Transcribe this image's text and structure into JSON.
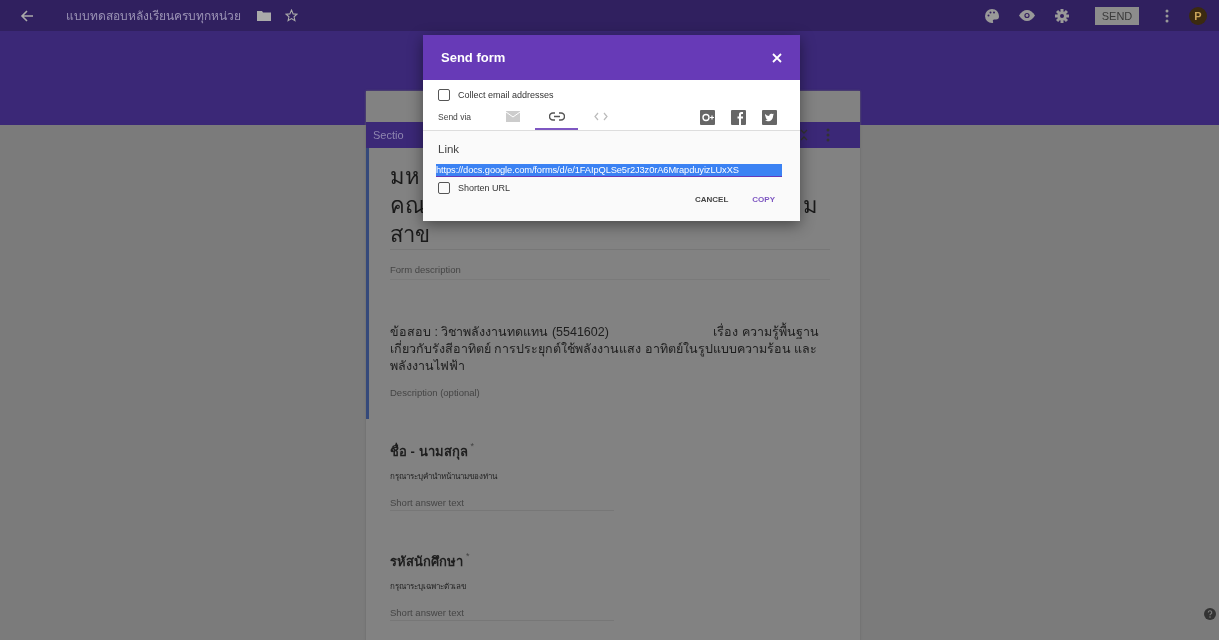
{
  "topbar": {
    "title": "แบบทดสอบหลังเรียนครบทุกหน่วย",
    "send_button": "SEND",
    "avatar": "P"
  },
  "form": {
    "section_tab": "Sectio",
    "title_lines": [
      {
        "left": "มห"
      },
      {
        "left": "คณ",
        "right": "ม"
      },
      {
        "left": "สาข"
      }
    ],
    "description_placeholder": "Form description",
    "text_block": {
      "text": "ข้อสอบ : วิชาพลังงานทดแทน (5541602)                              เรื่อง ความรู้พื้นฐานเกี่ยวกับรังสีอาทิตย์ การประยุกต์ใช้พลังงานแสง อาทิตย์ในรูปแบบความร้อน และ พลังงานไฟฟ้า",
      "placeholder": "Description (optional)"
    },
    "questions": [
      {
        "title": "ชื่อ - นามสกุล",
        "mark": "*",
        "description": "กรุณาระบุคำนำหน้านามของท่าน",
        "placeholder": "Short answer text"
      },
      {
        "title": "รหัสนักศึกษา",
        "mark": "*",
        "description": "กรุณาระบุเฉพาะตัวเลข",
        "placeholder": "Short answer text"
      }
    ]
  },
  "dialog": {
    "title": "Send form",
    "collect_email": {
      "label": "Collect email addresses",
      "checked": false
    },
    "send_via_label": "Send via",
    "via_tabs": [
      {
        "kind": "email",
        "selected": false
      },
      {
        "kind": "link",
        "selected": true
      },
      {
        "kind": "embed",
        "selected": false
      }
    ],
    "link_heading": "Link",
    "link_value": "https://docs.google.com/forms/d/e/1FAIpQLSe5r2J3z0rA6MrapduyizLUxXS",
    "shorten_url": {
      "label": "Shorten URL",
      "checked": false
    },
    "buttons": [
      {
        "label": "CANCEL",
        "kind": "cancel"
      },
      {
        "label": "COPY",
        "kind": "primary"
      }
    ]
  }
}
